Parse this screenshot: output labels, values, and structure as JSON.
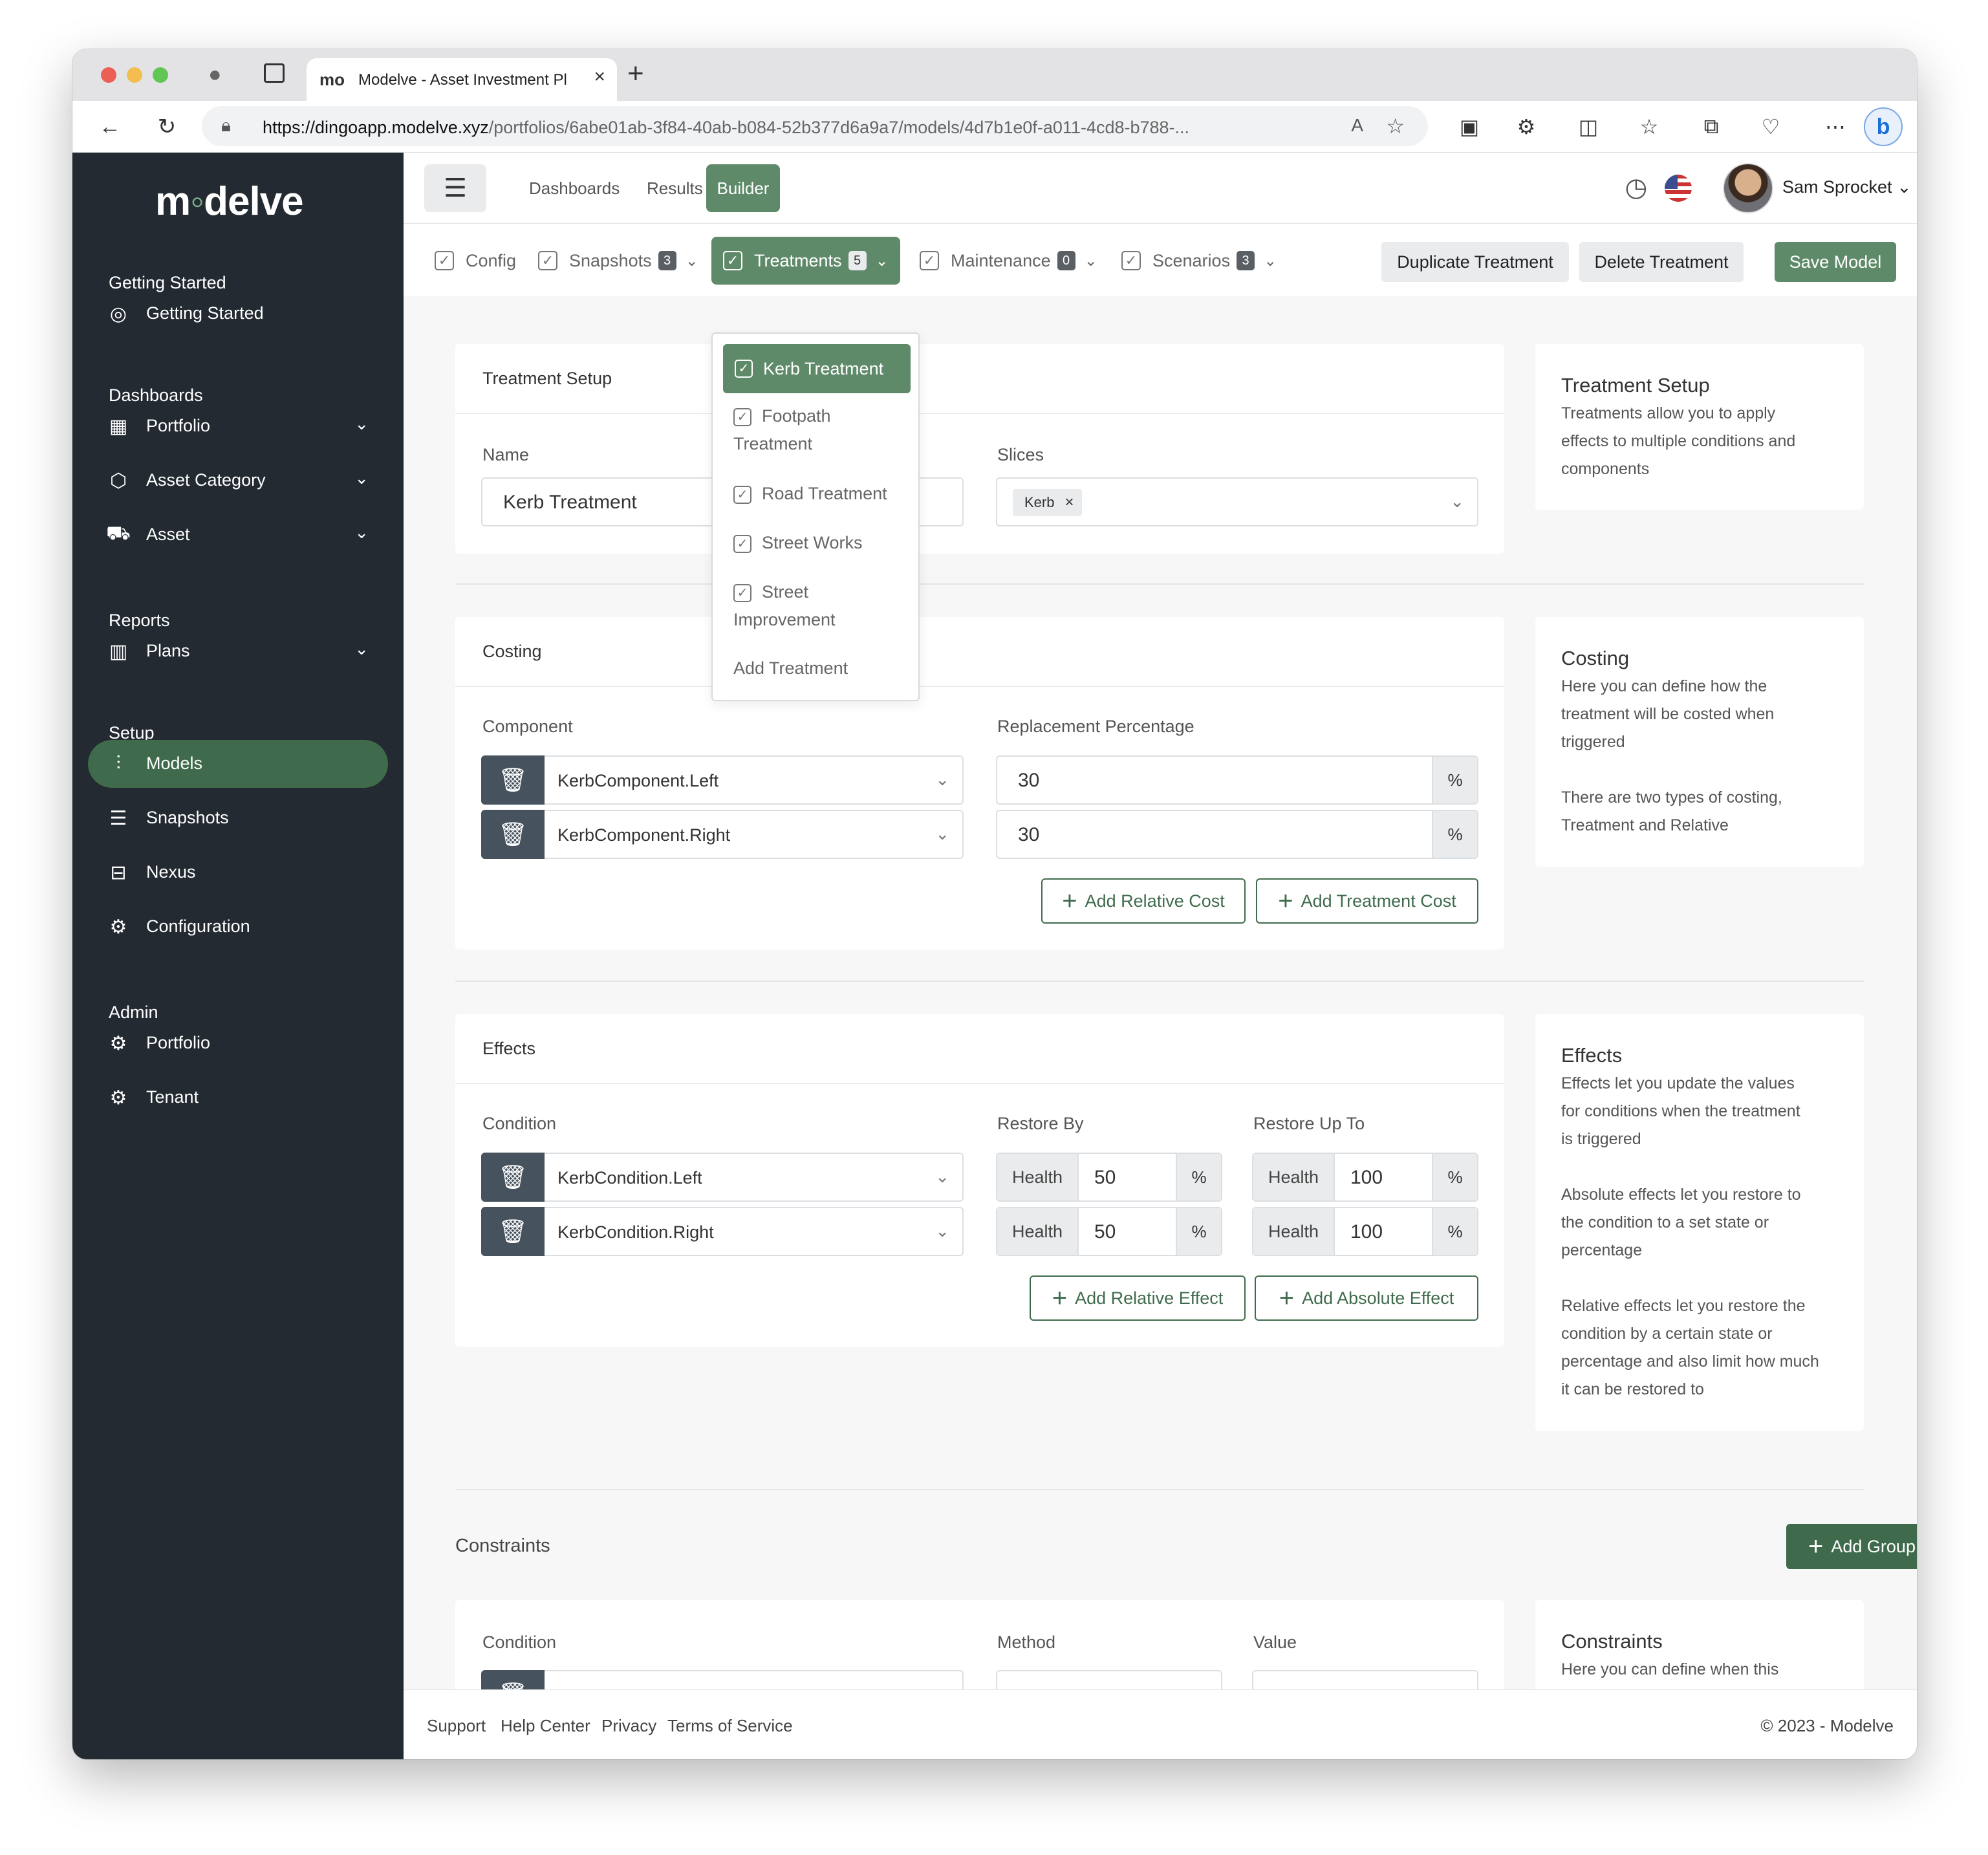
{
  "browser": {
    "tab_title": "Modelve - Asset Investment Pl",
    "tab_logo": "mo",
    "url_host": "https://dingoapp.modelve.xyz",
    "url_path": "/portfolios/6abe01ab-3f84-40ab-b084-52b377d6a9a7/models/4d7b1e0f-a011-4cd8-b788-..."
  },
  "sidebar": {
    "logo_pre": "m",
    "logo_dot": "◦",
    "logo_post": "delve",
    "sections": [
      {
        "title": "Getting Started",
        "items": [
          {
            "label": "Getting Started",
            "icon": "aperture-icon",
            "chevron": false
          }
        ]
      },
      {
        "title": "Dashboards",
        "items": [
          {
            "label": "Portfolio",
            "icon": "grid-icon",
            "chevron": true
          },
          {
            "label": "Asset Category",
            "icon": "cube-icon",
            "chevron": true
          },
          {
            "label": "Asset",
            "icon": "truck-icon",
            "chevron": true
          }
        ]
      },
      {
        "title": "Reports",
        "items": [
          {
            "label": "Plans",
            "icon": "map-icon",
            "chevron": true
          }
        ]
      },
      {
        "title": "Setup",
        "items": [
          {
            "label": "Models",
            "icon": "sliders-icon",
            "chevron": false,
            "active": true
          },
          {
            "label": "Snapshots",
            "icon": "database-icon",
            "chevron": false
          },
          {
            "label": "Nexus",
            "icon": "server-icon",
            "chevron": false
          },
          {
            "label": "Configuration",
            "icon": "gear-icon",
            "chevron": false
          }
        ]
      },
      {
        "title": "Admin",
        "items": [
          {
            "label": "Portfolio",
            "icon": "gear-icon",
            "chevron": false
          },
          {
            "label": "Tenant",
            "icon": "gear-icon",
            "chevron": false
          }
        ]
      }
    ]
  },
  "topbar": {
    "nav": [
      "Dashboards",
      "Results",
      "Builder"
    ],
    "user_name": "Sam Sprocket"
  },
  "subbar": {
    "tabs": [
      {
        "label": "Config"
      },
      {
        "label": "Snapshots",
        "count": "3"
      },
      {
        "label": "Treatments",
        "count": "5"
      },
      {
        "label": "Maintenance",
        "count": "0"
      },
      {
        "label": "Scenarios",
        "count": "3"
      }
    ],
    "duplicate_label": "Duplicate Treatment",
    "delete_label": "Delete Treatment",
    "save_label": "Save Model"
  },
  "treatments_menu": {
    "items": [
      "Kerb Treatment",
      "Footpath Treatment",
      "Road Treatment",
      "Street Works",
      "Street Improvement"
    ],
    "add_label": "Add Treatment"
  },
  "setup": {
    "title": "Treatment Setup",
    "name_label": "Name",
    "name_value": "Kerb Treatment",
    "slices_label": "Slices",
    "slice_tag": "Kerb"
  },
  "costing": {
    "title": "Costing",
    "component_label": "Component",
    "replacement_label": "Replacement Percentage",
    "rows": [
      {
        "component": "KerbComponent.Left",
        "percentage": "30",
        "unit": "%"
      },
      {
        "component": "KerbComponent.Right",
        "percentage": "30",
        "unit": "%"
      }
    ],
    "add_relative": "Add Relative Cost",
    "add_treatment": "Add Treatment Cost"
  },
  "effects": {
    "title": "Effects",
    "condition_label": "Condition",
    "restore_by_label": "Restore By",
    "restore_up_label": "Restore Up To",
    "rows": [
      {
        "condition": "KerbCondition.Left",
        "by_prefix": "Health",
        "by_value": "50",
        "by_unit": "%",
        "up_prefix": "Health",
        "up_value": "100",
        "up_unit": "%"
      },
      {
        "condition": "KerbCondition.Right",
        "by_prefix": "Health",
        "by_value": "50",
        "by_unit": "%",
        "up_prefix": "Health",
        "up_value": "100",
        "up_unit": "%"
      }
    ],
    "add_relative": "Add Relative Effect",
    "add_absolute": "Add Absolute Effect"
  },
  "constraints": {
    "title": "Constraints",
    "add_group": "Add Group",
    "condition_label": "Condition",
    "method_label": "Method",
    "value_label": "Value"
  },
  "info": {
    "setup": {
      "title": "Treatment Setup",
      "lines": [
        "Treatments allow you to apply",
        "effects to multiple conditions and",
        "components"
      ]
    },
    "costing": {
      "title": "Costing",
      "lines": [
        "Here you can define how the",
        "treatment will be costed when",
        "triggered",
        "",
        "There are two types of costing,",
        "Treatment and Relative"
      ]
    },
    "effects": {
      "title": "Effects",
      "lines": [
        "Effects let you update the values",
        "for conditions when the treatment",
        "is triggered",
        "",
        "Absolute effects let you restore to",
        "the condition to a set state or",
        "percentage",
        "",
        "Relative effects let you restore the",
        "condition by a certain state or",
        "percentage and also limit how much",
        "it can be restored to"
      ]
    },
    "constraints": {
      "title": "Constraints",
      "lines": [
        "Here you can define when this"
      ]
    }
  },
  "footer": {
    "links": [
      "Support",
      "Help Center",
      "Privacy",
      "Terms of Service"
    ],
    "copyright": "© 2023 - Modelve"
  },
  "colors": {
    "sidebar": "#232a31",
    "accent": "#5e8a69",
    "accent_dark": "#3f6b4c"
  }
}
